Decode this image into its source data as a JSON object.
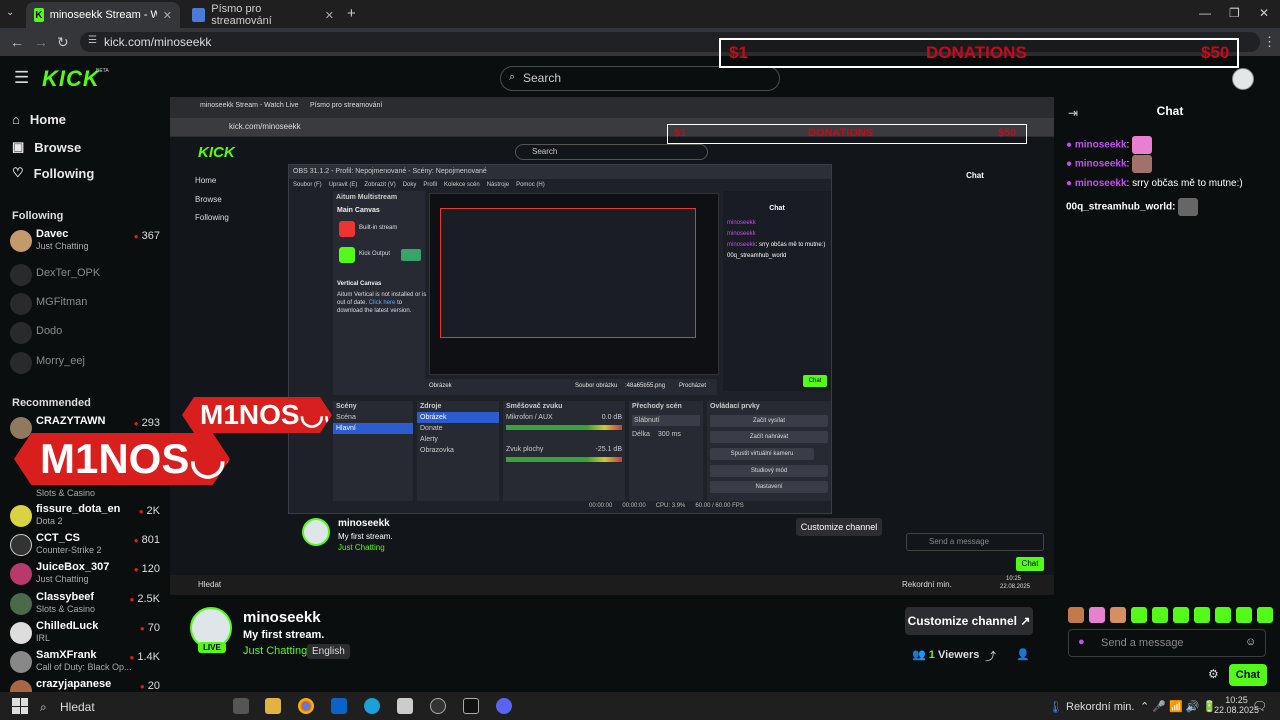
{
  "browser": {
    "tabs": [
      {
        "title": "minoseekk Stream - Watch Live"
      },
      {
        "title": "Písmo pro streamování"
      }
    ],
    "new_tab": "+",
    "url": "kick.com/minoseekk"
  },
  "donation": {
    "left": "$1",
    "center": "DONATIONS",
    "right": "$50"
  },
  "kick": {
    "logo": "KICK",
    "beta": "BETA",
    "search_placeholder": "Search"
  },
  "sidebar": {
    "nav": [
      {
        "label": "Home"
      },
      {
        "label": "Browse"
      },
      {
        "label": "Following"
      }
    ],
    "following_title": "Following",
    "following": [
      {
        "name": "Davec",
        "category": "Just Chatting",
        "viewers": "367",
        "online": true
      },
      {
        "name": "DexTer_OPK",
        "category": "",
        "viewers": "",
        "online": false
      },
      {
        "name": "MGFitman",
        "category": "",
        "viewers": "",
        "online": false
      },
      {
        "name": "Dodo",
        "category": "",
        "viewers": "",
        "online": false
      },
      {
        "name": "Morry_eej",
        "category": "",
        "viewers": "",
        "online": false
      }
    ],
    "recommended_title": "Recommended",
    "recommended": [
      {
        "name": "CRAZYTAWN",
        "category": "",
        "viewers": "293"
      },
      {
        "name": "",
        "category": "Slots & Casino",
        "viewers": "801"
      },
      {
        "name": "fissure_dota_en",
        "category": "Dota 2",
        "viewers": "2K"
      },
      {
        "name": "CCT_CS",
        "category": "Counter-Strike 2",
        "viewers": "801"
      },
      {
        "name": "JuiceBox_307",
        "category": "Just Chatting",
        "viewers": "120"
      },
      {
        "name": "Classybeef",
        "category": "Slots & Casino",
        "viewers": "2.5K"
      },
      {
        "name": "ChilledLuck",
        "category": "IRL",
        "viewers": "70"
      },
      {
        "name": "SamXFrank",
        "category": "Call of Duty: Black Op...",
        "viewers": "1.4K"
      },
      {
        "name": "crazyjapanese",
        "category": "",
        "viewers": "20"
      }
    ]
  },
  "overlay": {
    "logo_text": "M1NOS",
    "smile": "◡◡"
  },
  "obs": {
    "title": "OBS 31.1.2 - Profil: Nepojmenované - Scény: Nepojmenované",
    "menu": [
      "Soubor (F)",
      "Upravit (E)",
      "Zobrazit (V)",
      "Doky",
      "Profil",
      "Kolekce scén",
      "Nástroje",
      "Pomoc (H)"
    ],
    "multistream_title": "Aitum Multistream",
    "main_canvas": "Main Canvas",
    "builtin": "Built-in stream",
    "kick_output": "Kick Output",
    "vertical_canvas": "Vertical Canvas",
    "vertical_msg": "Aitum Vertical is not installed or is out of date.",
    "click_here": "Click here",
    "download_msg": "to download the latest version.",
    "scenes_title": "Scény",
    "scenes": [
      "Scéna",
      "Hlavní"
    ],
    "sources_title": "Zdroje",
    "sources": [
      "Obrázek",
      "Donate",
      "Alerty",
      "Obrazovka"
    ],
    "mixer_title": "Směšovač zvuku",
    "mixer": [
      {
        "name": "Mikrofon / AUX",
        "db": "0.0 dB"
      },
      {
        "name": "Zvuk plochy",
        "db": "-25.1 dB"
      }
    ],
    "transitions_title": "Přechody scén",
    "transition": "Slábnutí",
    "duration_label": "Délka",
    "duration": "300 ms",
    "controls_title": "Ovládací prvky",
    "controls": [
      "Začít vysílat",
      "Začít nahrávat",
      "Spustit virtuální kameru",
      "Studiový mód",
      "Nastavení"
    ],
    "source_bar": {
      "name": "Obrázek",
      "file_label": "Soubor obrázku",
      "file": ":48a65b55.png",
      "browse": "Procházet"
    },
    "status": {
      "t1": "00:00:00",
      "t2": "00:00:00",
      "cpu": "CPU: 3.9%",
      "fps": "60.00 / 60.00 FPS"
    },
    "dock_chat_title": "Chat"
  },
  "stream_info": {
    "live": "LIVE",
    "channel": "minoseekk",
    "title": "My first stream.",
    "category": "Just Chatting",
    "language": "English",
    "customize": "Customize channel",
    "viewers_count": "1",
    "viewers_label": "Viewers"
  },
  "chat": {
    "title": "Chat",
    "messages": [
      {
        "user": "minoseekk",
        "text": ""
      },
      {
        "user": "minoseekk",
        "text": ""
      },
      {
        "user": "minoseekk",
        "text": "srry občas mě to mutne:)"
      },
      {
        "user": "00q_streamhub_world",
        "text": ""
      }
    ],
    "placeholder": "Send a message",
    "send": "Chat"
  },
  "taskbar": {
    "search": "Hledat",
    "mode": "Rekordní min.",
    "time": "10:25",
    "date": "22.08.2025"
  },
  "colors": {
    "kick_green": "#53fc18",
    "live_red": "#e91916",
    "donation_red": "#c8091b",
    "chat_user": "#c44ff0"
  }
}
